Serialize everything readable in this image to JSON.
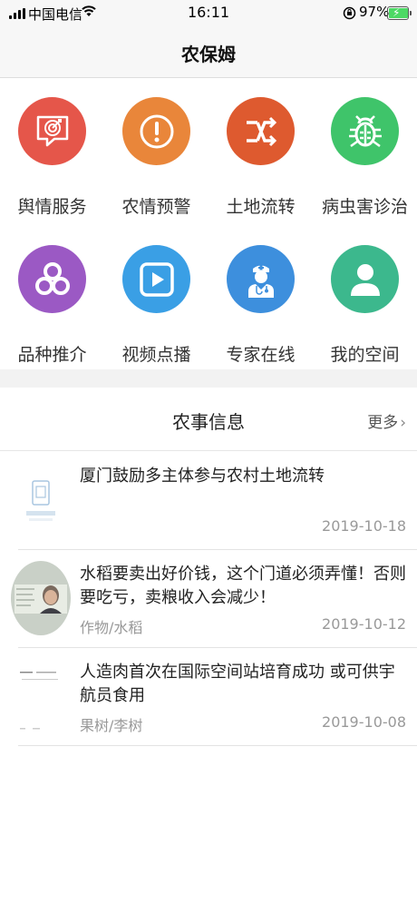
{
  "status_bar": {
    "carrier": "中国电信",
    "time": "16:11",
    "battery": "97%"
  },
  "nav": {
    "title": "农保姆"
  },
  "grid": [
    {
      "label": "舆情服务",
      "icon": "target-chat-icon",
      "color": "#e5564a"
    },
    {
      "label": "农情预警",
      "icon": "alert-icon",
      "color": "#e9863a"
    },
    {
      "label": "土地流转",
      "icon": "transfer-icon",
      "color": "#de5a2f"
    },
    {
      "label": "病虫害诊治",
      "icon": "bug-icon",
      "color": "#3fc46a"
    },
    {
      "label": "品种推介",
      "icon": "three-circles-icon",
      "color": "#9b59c4"
    },
    {
      "label": "视频点播",
      "icon": "play-icon",
      "color": "#3a9fe5"
    },
    {
      "label": "专家在线",
      "icon": "doctor-icon",
      "color": "#3d8fdd"
    },
    {
      "label": "我的空间",
      "icon": "user-icon",
      "color": "#3cb88d"
    }
  ],
  "news": {
    "title": "农事信息",
    "more": "更多",
    "items": [
      {
        "title": "厦门鼓励多主体参与农村土地流转",
        "category": "",
        "date": "2019-10-18",
        "thumb": "no-image-icon"
      },
      {
        "title": "水稻要卖出好价钱，这个门道必须弄懂！否则要吃亏，卖粮收入会减少！",
        "category": "作物/水稻",
        "date": "2019-10-12",
        "thumb": "portrait-photo"
      },
      {
        "title": "人造肉首次在国际空间站培育成功 或可供宇航员食用",
        "category": "果树/李树",
        "date": "2019-10-08",
        "thumb": "document-photo"
      }
    ]
  }
}
